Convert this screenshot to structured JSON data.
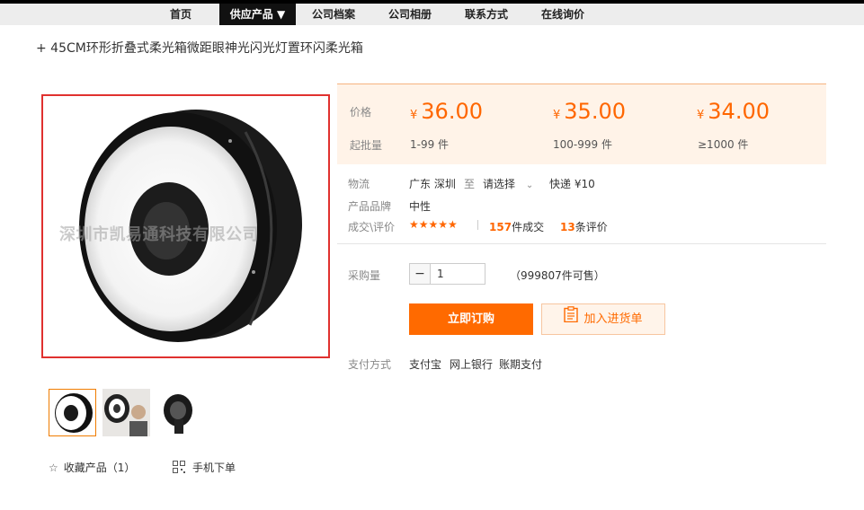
{
  "nav": {
    "items": [
      {
        "label": "首页"
      },
      {
        "label": "供应产品 ▼"
      },
      {
        "label": "公司档案"
      },
      {
        "label": "公司相册"
      },
      {
        "label": "联系方式"
      },
      {
        "label": "在线询价"
      }
    ],
    "active_index": 1
  },
  "product": {
    "title": "+ 45CM环形折叠式柔光箱微距眼神光闪光灯置环闪柔光箱",
    "watermark": "深圳市凯易通科技有限公司",
    "thumbnail_count": 3
  },
  "actions": {
    "favorite": "收藏产品（1）",
    "mobile_order": "手机下单"
  },
  "pricing": {
    "price_label": "价格",
    "moq_label": "起批量",
    "currency": "¥",
    "tiers": [
      {
        "price": "36.00",
        "range": "1-99 件"
      },
      {
        "price": "35.00",
        "range": "100-999 件"
      },
      {
        "price": "34.00",
        "range": "≥1000 件"
      }
    ]
  },
  "logistics": {
    "label": "物流",
    "from": "广东 深圳",
    "to_word": "至",
    "select": "请选择",
    "method": "快递 ¥10"
  },
  "brand": {
    "label": "产品品牌",
    "value": "中性"
  },
  "reviews": {
    "label": "成交\\评价",
    "stars": "★★★★★",
    "rating": 5,
    "deals_count": "157",
    "deals_suffix": "件成交",
    "reviews_count": "13",
    "reviews_suffix": "条评价"
  },
  "purchase": {
    "qty_label": "采购量",
    "minus": "−",
    "quantity": "1",
    "available": "（999807件可售）",
    "buy_button": "立即订购",
    "cart_button": "加入进货单"
  },
  "payment": {
    "label": "支付方式",
    "methods": [
      "支付宝",
      "网上银行",
      "账期支付"
    ]
  },
  "colors": {
    "accent": "#ff6600",
    "highlight_border": "#e0312f",
    "price_bg": "#fff3e8"
  }
}
